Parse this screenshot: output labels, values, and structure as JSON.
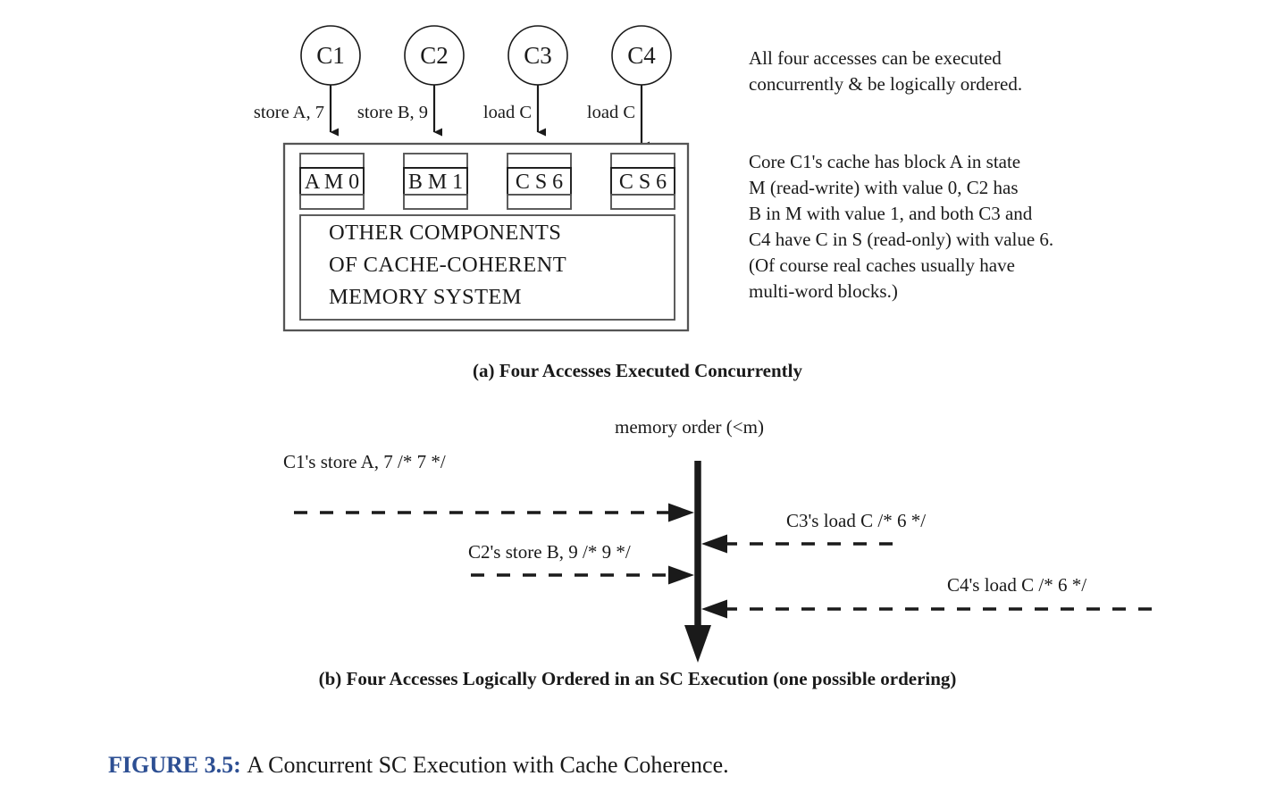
{
  "figure": {
    "number_label": "FIGURE 3.5:",
    "description": "A Concurrent SC Execution with Cache Coherence.",
    "number_color": "#2d4f93",
    "text_color": "#1a1a1a"
  },
  "panel_a": {
    "caption": "(a) Four Accesses Executed Concurrently",
    "cores": [
      {
        "label": "C1",
        "access": "store A, 7"
      },
      {
        "label": "C2",
        "access": "store B, 9"
      },
      {
        "label": "C3",
        "access": "load C"
      },
      {
        "label": "C4",
        "access": "load C"
      }
    ],
    "caches": [
      {
        "block": "A",
        "state": "M",
        "value": "0",
        "text": "A M 0"
      },
      {
        "block": "B",
        "state": "M",
        "value": "1",
        "text": "B M 1"
      },
      {
        "block": "C",
        "state": "S",
        "value": "6",
        "text": "C S 6"
      },
      {
        "block": "C",
        "state": "S",
        "value": "6",
        "text": "C S 6"
      }
    ],
    "memory_system_lines": [
      "OTHER COMPONENTS",
      "OF CACHE-COHERENT",
      "MEMORY SYSTEM"
    ],
    "annotation": {
      "paragraph1": [
        "All four accesses can be executed",
        "concurrently & be logically ordered."
      ],
      "paragraph2": [
        "Core C1's cache has block A in state",
        "M (read-write) with value 0, C2 has",
        "B in M with value 1, and both C3 and",
        "C4 have C in S (read-only) with value 6.",
        "(Of course real caches usually have",
        "multi-word blocks.)"
      ]
    }
  },
  "panel_b": {
    "caption": "(b) Four Accesses Logically Ordered in an SC Execution (one possible ordering)",
    "memory_order_title": "memory order (<m)",
    "operations": [
      {
        "label": "C1's store A, 7 /* 7 */",
        "side": "left",
        "direction": "to-axis"
      },
      {
        "label": "C2's store B, 9 /* 9 */",
        "side": "left",
        "direction": "to-axis"
      },
      {
        "label": "C3's load C /* 6 */",
        "side": "right",
        "direction": "to-axis"
      },
      {
        "label": "C4's load C /* 6 */",
        "side": "right",
        "direction": "to-axis"
      }
    ]
  }
}
